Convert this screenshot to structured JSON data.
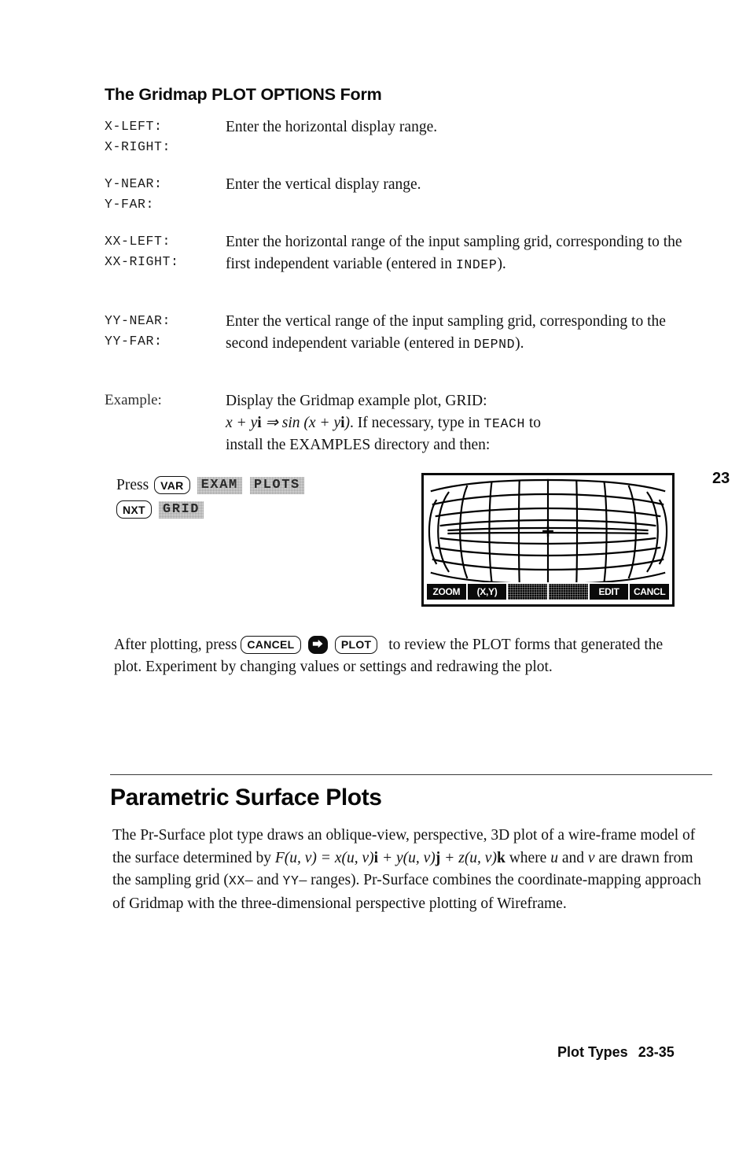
{
  "section": {
    "heading": "The Gridmap PLOT OPTIONS Form"
  },
  "fields": [
    {
      "labels": [
        "X-LEFT:",
        "X-RIGHT:"
      ],
      "description": "Enter the horizontal display range."
    },
    {
      "labels": [
        "Y-NEAR:",
        "Y-FAR:"
      ],
      "description": "Enter the vertical display range."
    },
    {
      "labels": [
        "XX-LEFT:",
        "XX-RIGHT:"
      ],
      "description_part1": "Enter the horizontal range of the input sampling grid, corresponding to the first independent variable (entered in ",
      "keyword": "INDEP",
      "description_part2": ")."
    },
    {
      "labels": [
        "YY-NEAR:",
        "YY-FAR:"
      ],
      "description_part1": "Enter the vertical range of the input sampling grid, corresponding to the second independent variable (entered in ",
      "keyword": "DEPND",
      "description_part2": ")."
    }
  ],
  "example": {
    "label": "Example:",
    "line1": "Display the Gridmap example plot, GRID:",
    "math_lhs_x": "x",
    "math_plus": " + ",
    "math_y": "y",
    "math_i": "i",
    "math_implies": " ⇒ ",
    "math_sin": "sin",
    "math_open": " (",
    "math_close": ")",
    "after_math": ". If necessary, type in ",
    "keyword_teach": "TEACH",
    "after_teach": " to",
    "line3": "install the EXAMPLES directory and then:"
  },
  "press": {
    "press_word": "Press",
    "key_var": "VAR",
    "softkey_exam": "EXAM",
    "softkey_plots": "PLOTS",
    "key_nxt": "NXT",
    "softkey_grid": "GRID"
  },
  "chapter_tab": "23",
  "calculator": {
    "softkeys": [
      "ZOOM",
      "(X,Y)",
      "",
      "",
      "EDIT",
      "CANCL"
    ],
    "cursor": "+"
  },
  "after_plot": {
    "text1": "After plotting, press ",
    "key_cancel": "CANCEL",
    "key_right_shift": "⮕",
    "key_plot": "PLOT",
    "text2": " to review the PLOT forms that generated the plot. Experiment by changing values or settings and redrawing the plot."
  },
  "parametric": {
    "heading": "Parametric Surface Plots",
    "para_1": "The Pr-Surface plot type draws an oblique-view, perspective, 3D plot of a wire-frame model of the surface determined by ",
    "formula": {
      "F": "F",
      "uv_1": "(u, v)",
      "eq": " = ",
      "x": "x",
      "uv_2": "(u, v)",
      "i": "i",
      "plus_1": " + ",
      "y": "y",
      "uv_3": "(u, v)",
      "j": "j",
      "plus_2": " + ",
      "z": "z",
      "uv_4": "(u, v)",
      "k": "k"
    },
    "para_2a": " where ",
    "var_u": "u",
    "para_2b": " and ",
    "var_v": "v",
    "para_2c": " are drawn from the sampling grid (",
    "kw_xx": "XX",
    "para_2d": "– and ",
    "kw_yy": "YY",
    "para_2e": "– ranges). Pr-Surface combines the coordinate-mapping approach of Gridmap with the three-dimensional perspective plotting of Wireframe."
  },
  "footer": {
    "title": "Plot Types",
    "page": "23-35"
  }
}
